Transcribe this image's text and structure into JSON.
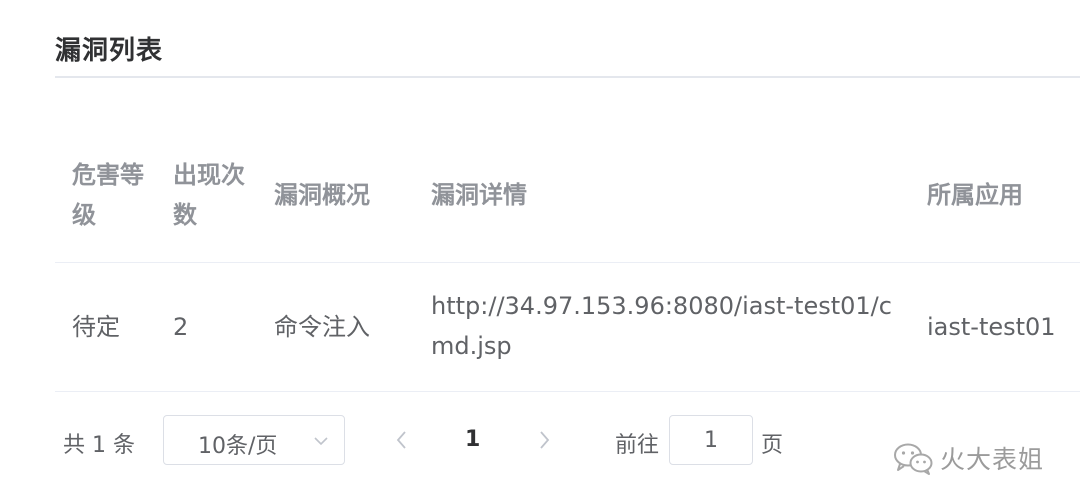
{
  "section": {
    "title": "漏洞列表"
  },
  "table": {
    "headers": {
      "severity": "危害等级",
      "count": "出现次数",
      "overview": "漏洞概况",
      "details": "漏洞详情",
      "app": "所属应用"
    },
    "rows": [
      {
        "severity": "待定",
        "count": "2",
        "overview": "命令注入",
        "details": "http://34.97.153.96:8080/iast-test01/cmd.jsp",
        "app": "iast-test01"
      }
    ]
  },
  "pagination": {
    "total_text": "共 1 条",
    "page_size": "10条/页",
    "current_page": "1",
    "goto_label": "前往",
    "goto_value": "1",
    "goto_suffix": "页"
  },
  "watermark": {
    "text": "火大表姐",
    "icon": "wechat-icon"
  },
  "colors": {
    "header_text": "#909399",
    "body_text": "#606266",
    "border": "#ebeef5",
    "title_text": "#303133"
  }
}
